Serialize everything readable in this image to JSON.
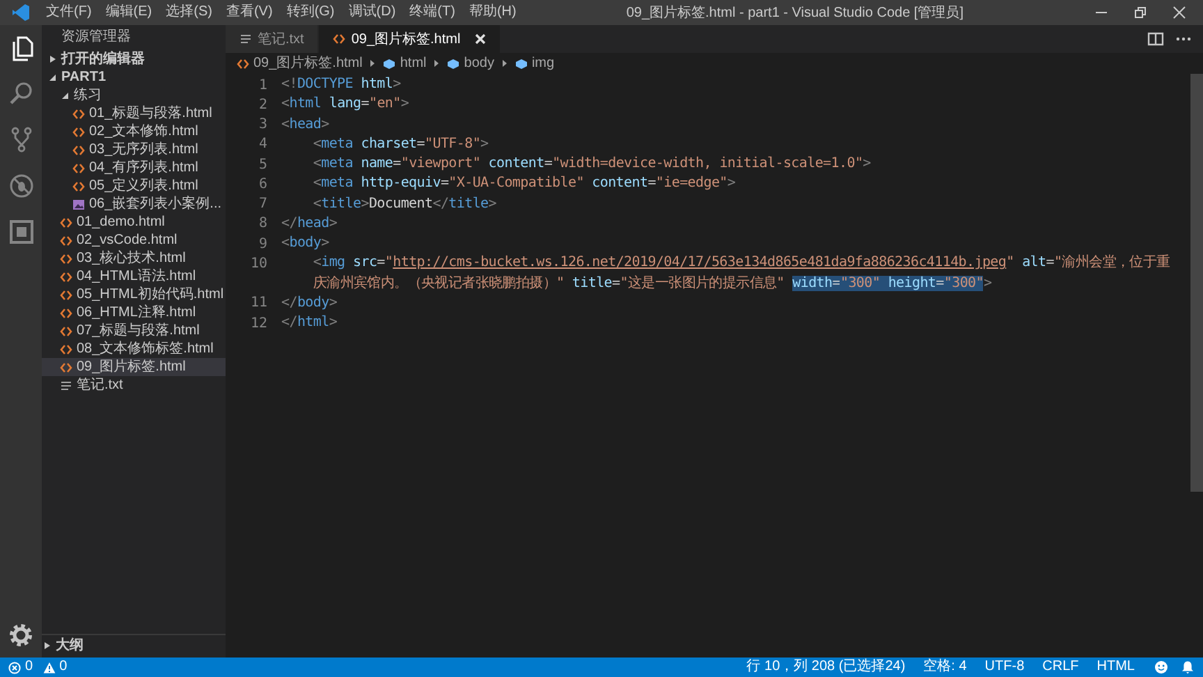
{
  "window": {
    "title": "09_图片标签.html - part1 - Visual Studio Code [管理员]"
  },
  "menu": [
    "文件(F)",
    "编辑(E)",
    "选择(S)",
    "查看(V)",
    "转到(G)",
    "调试(D)",
    "终端(T)",
    "帮助(H)"
  ],
  "activity_bar": [
    {
      "kind": "files",
      "selected": true
    },
    {
      "kind": "search",
      "selected": false
    },
    {
      "kind": "scm",
      "selected": false
    },
    {
      "kind": "debug",
      "selected": false
    },
    {
      "kind": "extensions",
      "selected": false
    }
  ],
  "sidebar": {
    "title": "资源管理器",
    "items": [
      {
        "label": "打开的编辑器",
        "kind": "section",
        "expanded": false,
        "selected": false
      },
      {
        "label": "PART1",
        "kind": "section",
        "expanded": true,
        "selected": false,
        "children": [
          {
            "label": "练习",
            "kind": "folder",
            "expanded": true,
            "selected": false,
            "children": [
              {
                "label": "01_标题与段落.html",
                "kind": "html",
                "selected": false
              },
              {
                "label": "02_文本修饰.html",
                "kind": "html",
                "selected": false
              },
              {
                "label": "03_无序列表.html",
                "kind": "html",
                "selected": false
              },
              {
                "label": "04_有序列表.html",
                "kind": "html",
                "selected": false
              },
              {
                "label": "05_定义列表.html",
                "kind": "html",
                "selected": false
              },
              {
                "label": "06_嵌套列表小案例...",
                "kind": "image",
                "selected": false
              }
            ]
          },
          {
            "label": "01_demo.html",
            "kind": "html",
            "selected": false
          },
          {
            "label": "02_vsCode.html",
            "kind": "html",
            "selected": false
          },
          {
            "label": "03_核心技术.html",
            "kind": "html",
            "selected": false
          },
          {
            "label": "04_HTML语法.html",
            "kind": "html",
            "selected": false
          },
          {
            "label": "05_HTML初始代码.html",
            "kind": "html",
            "selected": false
          },
          {
            "label": "06_HTML注释.html",
            "kind": "html",
            "selected": false
          },
          {
            "label": "07_标题与段落.html",
            "kind": "html",
            "selected": false
          },
          {
            "label": "08_文本修饰标签.html",
            "kind": "html",
            "selected": false
          },
          {
            "label": "09_图片标签.html",
            "kind": "html",
            "selected": true
          },
          {
            "label": "笔记.txt",
            "kind": "txt",
            "selected": false
          }
        ]
      }
    ],
    "outline": {
      "label": "大纲",
      "expanded": false
    }
  },
  "tabs": [
    {
      "label": "笔记.txt",
      "kind": "txt",
      "selected": false
    },
    {
      "label": "09_图片标签.html",
      "kind": "html",
      "selected": true
    }
  ],
  "breadcrumb": [
    {
      "label": "09_图片标签.html",
      "kind": "html"
    },
    {
      "label": "html",
      "kind": "element"
    },
    {
      "label": "body",
      "kind": "element"
    },
    {
      "label": "img",
      "kind": "element"
    }
  ],
  "code_lines": [
    {
      "number": "1",
      "rows": [
        {
          "tokens": [
            {
              "kind": "punct",
              "text": "<!"
            },
            {
              "kind": "tag",
              "text": "DOCTYPE"
            },
            {
              "kind": "attr",
              "text": " html"
            },
            {
              "kind": "punct",
              "text": ">"
            }
          ]
        }
      ]
    },
    {
      "number": "2",
      "rows": [
        {
          "tokens": [
            {
              "kind": "punct",
              "text": "<"
            },
            {
              "kind": "tag",
              "text": "html"
            },
            {
              "kind": "attr",
              "text": " lang"
            },
            {
              "kind": "text",
              "text": "="
            },
            {
              "kind": "string",
              "text": "\"en\""
            },
            {
              "kind": "punct",
              "text": ">"
            }
          ]
        }
      ]
    },
    {
      "number": "3",
      "rows": [
        {
          "tokens": [
            {
              "kind": "punct",
              "text": "<"
            },
            {
              "kind": "tag",
              "text": "head"
            },
            {
              "kind": "punct",
              "text": ">"
            }
          ]
        }
      ]
    },
    {
      "number": "4",
      "rows": [
        {
          "tokens": [
            {
              "kind": "punct",
              "text": "    <"
            },
            {
              "kind": "tag",
              "text": "meta"
            },
            {
              "kind": "attr",
              "text": " charset"
            },
            {
              "kind": "text",
              "text": "="
            },
            {
              "kind": "string",
              "text": "\"UTF-8\""
            },
            {
              "kind": "punct",
              "text": ">"
            }
          ]
        }
      ]
    },
    {
      "number": "5",
      "rows": [
        {
          "tokens": [
            {
              "kind": "punct",
              "text": "    <"
            },
            {
              "kind": "tag",
              "text": "meta"
            },
            {
              "kind": "attr",
              "text": " name"
            },
            {
              "kind": "text",
              "text": "="
            },
            {
              "kind": "string",
              "text": "\"viewport\""
            },
            {
              "kind": "attr",
              "text": " content"
            },
            {
              "kind": "text",
              "text": "="
            },
            {
              "kind": "string",
              "text": "\"width=device-width, initial-scale=1.0\""
            },
            {
              "kind": "punct",
              "text": ">"
            }
          ]
        }
      ]
    },
    {
      "number": "6",
      "rows": [
        {
          "tokens": [
            {
              "kind": "punct",
              "text": "    <"
            },
            {
              "kind": "tag",
              "text": "meta"
            },
            {
              "kind": "attr",
              "text": " http-equiv"
            },
            {
              "kind": "text",
              "text": "="
            },
            {
              "kind": "string",
              "text": "\"X-UA-Compatible\""
            },
            {
              "kind": "attr",
              "text": " content"
            },
            {
              "kind": "text",
              "text": "="
            },
            {
              "kind": "string",
              "text": "\"ie=edge\""
            },
            {
              "kind": "punct",
              "text": ">"
            }
          ]
        }
      ]
    },
    {
      "number": "7",
      "rows": [
        {
          "tokens": [
            {
              "kind": "punct",
              "text": "    <"
            },
            {
              "kind": "tag",
              "text": "title"
            },
            {
              "kind": "punct",
              "text": ">"
            },
            {
              "kind": "text",
              "text": "Document"
            },
            {
              "kind": "punct",
              "text": "</"
            },
            {
              "kind": "tag",
              "text": "title"
            },
            {
              "kind": "punct",
              "text": ">"
            }
          ]
        }
      ]
    },
    {
      "number": "8",
      "rows": [
        {
          "tokens": [
            {
              "kind": "punct",
              "text": "</"
            },
            {
              "kind": "tag",
              "text": "head"
            },
            {
              "kind": "punct",
              "text": ">"
            }
          ]
        }
      ]
    },
    {
      "number": "9",
      "rows": [
        {
          "tokens": [
            {
              "kind": "punct",
              "text": "<"
            },
            {
              "kind": "tag",
              "text": "body"
            },
            {
              "kind": "punct",
              "text": ">"
            }
          ]
        }
      ]
    },
    {
      "number": "10",
      "rows": [
        {
          "tokens": [
            {
              "kind": "punct",
              "text": "    <"
            },
            {
              "kind": "tag",
              "text": "img"
            },
            {
              "kind": "attr",
              "text": " src"
            },
            {
              "kind": "text",
              "text": "="
            },
            {
              "kind": "string",
              "text": "\""
            },
            {
              "kind": "link",
              "text": "http://cms-bucket.ws.126.net/2019/04/17/563e134d865e481da9fa886236c4114b.jpeg"
            },
            {
              "kind": "string",
              "text": "\""
            },
            {
              "kind": "attr",
              "text": " alt"
            },
            {
              "kind": "text",
              "text": "="
            },
            {
              "kind": "string",
              "text": "\"渝州会堂，位于重"
            }
          ]
        },
        {
          "tokens": [
            {
              "kind": "string",
              "text": "    庆渝州宾馆内。（央视记者张晓鹏拍摄）\"",
              "selected": false
            },
            {
              "kind": "attr",
              "text": " title",
              "selected": false
            },
            {
              "kind": "text",
              "text": "=",
              "selected": false
            },
            {
              "kind": "string",
              "text": "\"这是一张图片的提示信息\" ",
              "selected": false
            },
            {
              "kind": "attr",
              "text": "width",
              "selected": true
            },
            {
              "kind": "text",
              "text": "=",
              "selected": true
            },
            {
              "kind": "string",
              "text": "\"300\"",
              "selected": true
            },
            {
              "kind": "attr",
              "text": " height",
              "selected": true
            },
            {
              "kind": "text",
              "text": "=",
              "selected": true
            },
            {
              "kind": "string",
              "text": "\"300\"",
              "selected": true
            },
            {
              "kind": "punct",
              "text": ">",
              "selected": false
            }
          ]
        }
      ]
    },
    {
      "number": "11",
      "rows": [
        {
          "tokens": [
            {
              "kind": "punct",
              "text": "</"
            },
            {
              "kind": "tag",
              "text": "body"
            },
            {
              "kind": "punct",
              "text": ">"
            }
          ]
        }
      ]
    },
    {
      "number": "12",
      "rows": [
        {
          "tokens": [
            {
              "kind": "punct",
              "text": "</"
            },
            {
              "kind": "tag",
              "text": "html"
            },
            {
              "kind": "punct",
              "text": ">"
            }
          ]
        }
      ]
    }
  ],
  "status_bar": {
    "errors": "0",
    "warnings": "0",
    "items": [
      "行 10，列 208 (已选择24)",
      "空格: 4",
      "UTF-8",
      "CRLF",
      "HTML"
    ]
  }
}
